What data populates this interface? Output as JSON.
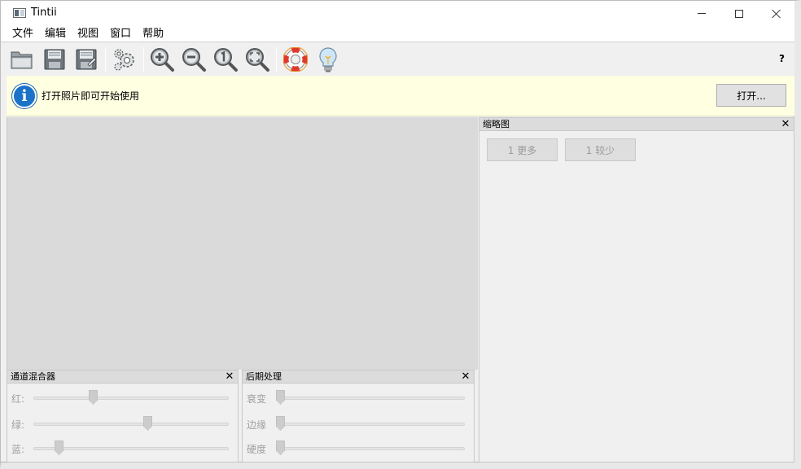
{
  "window": {
    "title": "Tintii"
  },
  "menubar": {
    "items": [
      "文件",
      "编辑",
      "视图",
      "窗口",
      "帮助"
    ]
  },
  "toolbar": {
    "buttons": [
      {
        "name": "open-folder-icon"
      },
      {
        "name": "save-icon"
      },
      {
        "name": "save-as-icon"
      },
      {
        "name": "settings-gear-icon"
      },
      {
        "name": "zoom-in-icon"
      },
      {
        "name": "zoom-out-icon"
      },
      {
        "name": "zoom-actual-size-icon"
      },
      {
        "name": "zoom-fit-icon"
      },
      {
        "name": "help-lifebuoy-icon"
      },
      {
        "name": "tip-lightbulb-icon"
      }
    ],
    "help_label": "?"
  },
  "infobar": {
    "message": "打开照片即可开始使用",
    "open_button": "打开..."
  },
  "channel_mixer": {
    "title": "通道混合器",
    "sliders": [
      {
        "label": "红:",
        "value": 0.3
      },
      {
        "label": "绿:",
        "value": 0.58
      },
      {
        "label": "蓝:",
        "value": 0.13
      }
    ]
  },
  "post_processing": {
    "title": "后期处理",
    "sliders": [
      {
        "label": "衰变",
        "value": 0.0
      },
      {
        "label": "边缘",
        "value": 0.0
      },
      {
        "label": "硬度",
        "value": 0.0
      }
    ]
  },
  "thumbnails": {
    "title": "缩略图",
    "more_button": "1 更多",
    "fewer_button": "1 较少"
  },
  "colors": {
    "info_background": "#ffffe1",
    "info_icon": "#1a73c9",
    "canvas_background": "#dadada"
  }
}
